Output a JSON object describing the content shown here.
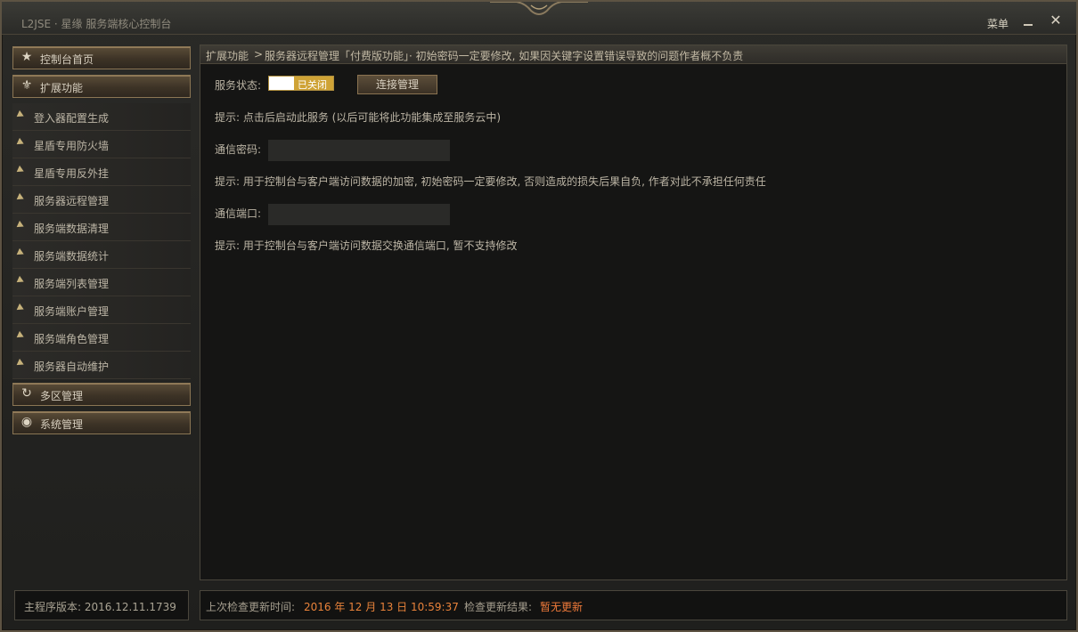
{
  "window": {
    "title": "L2JSE · 星缘 服务端核心控制台",
    "menu_label": "菜单",
    "close_glyph": "✕"
  },
  "sidebar": {
    "home_label": "控制台首页",
    "extend_label": "扩展功能",
    "sub_items": [
      "登入器配置生成",
      "星盾专用防火墙",
      "星盾专用反外挂",
      "服务器远程管理",
      "服务端数据清理",
      "服务端数据统计",
      "服务端列表管理",
      "服务端账户管理",
      "服务端角色管理",
      "服务器自动维护"
    ],
    "multi_zone_label": "多区管理",
    "system_label": "系统管理",
    "icons": {
      "home": "star-icon",
      "extend": "fleur-de-lis-icon",
      "multi_zone": "refresh-icon",
      "system": "eye-icon"
    }
  },
  "breadcrumb": {
    "part1": "扩展功能",
    "sep": ">",
    "part2": "服务器远程管理「付费版功能」·  初始密码一定要修改, 如果因关键字设置错误导致的问题作者概不负责"
  },
  "main": {
    "service_status_label": "服务状态:",
    "service_status_value": "已关闭",
    "connect_button": "连接管理",
    "hint1": "提示: 点击后启动此服务 (以后可能将此功能集成至服务云中)",
    "password_label": "通信密码:",
    "password_value": "",
    "hint2": "提示: 用于控制台与客户端访问数据的加密, 初始密码一定要修改, 否则造成的损失后果自负, 作者对此不承担任何责任",
    "port_label": "通信端口:",
    "port_value": "",
    "hint3": "提示: 用于控制台与客户端访问数据交换通信端口, 暂不支持修改"
  },
  "footer": {
    "version_label": "主程序版本: 2016.12.11.1739",
    "last_check_label": "上次检查更新时间:",
    "last_check_value": "2016 年 12 月 13 日 10:59:37",
    "result_label": "检查更新结果:",
    "result_value": "暂无更新"
  },
  "colors": {
    "accent_gold": "#cfa336",
    "update_orange": "#e8823a"
  }
}
